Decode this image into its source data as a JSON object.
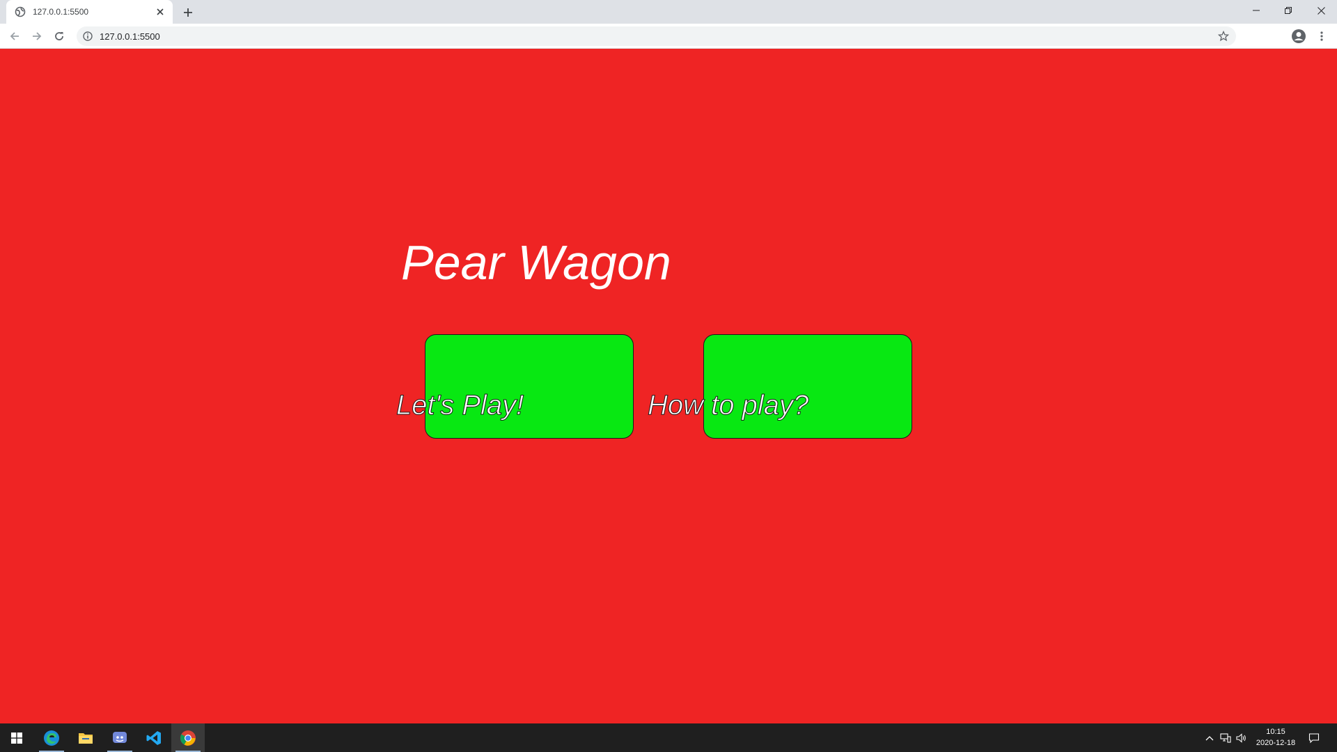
{
  "browser": {
    "tab_title": "127.0.0.1:5500",
    "url": "127.0.0.1:5500"
  },
  "page": {
    "title": "Pear Wagon",
    "buttons": [
      {
        "label": "Let's Play!"
      },
      {
        "label": "How to play?"
      }
    ],
    "colors": {
      "background": "#ef2424",
      "button_fill": "#08e812",
      "text": "#ffffff"
    }
  },
  "taskbar": {
    "apps": [
      "start-icon",
      "edge-icon",
      "file-explorer-icon",
      "discord-icon",
      "vscode-icon",
      "chrome-icon"
    ],
    "time": "10:15",
    "date": "2020-12-18"
  }
}
